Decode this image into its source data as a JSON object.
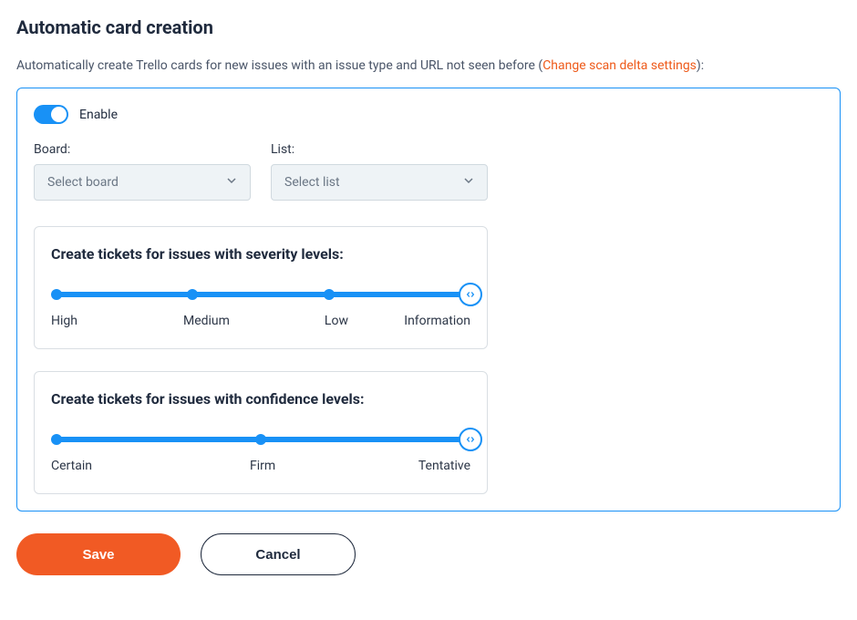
{
  "title": "Automatic card creation",
  "intro": {
    "text_before": "Automatically create Trello cards for new issues with an issue type and URL not seen before  (",
    "link": "Change scan delta settings",
    "text_after": "):"
  },
  "enable": {
    "label": "Enable",
    "on": true
  },
  "selects": {
    "board": {
      "label": "Board:",
      "placeholder": "Select board"
    },
    "list": {
      "label": "List:",
      "placeholder": "Select list"
    }
  },
  "severity": {
    "title": "Create tickets for issues with severity levels:",
    "labels": [
      "High",
      "Medium",
      "Low",
      "Information"
    ]
  },
  "confidence": {
    "title": "Create tickets for issues with confidence levels:",
    "labels": [
      "Certain",
      "Firm",
      "Tentative"
    ]
  },
  "buttons": {
    "save": "Save",
    "cancel": "Cancel"
  }
}
